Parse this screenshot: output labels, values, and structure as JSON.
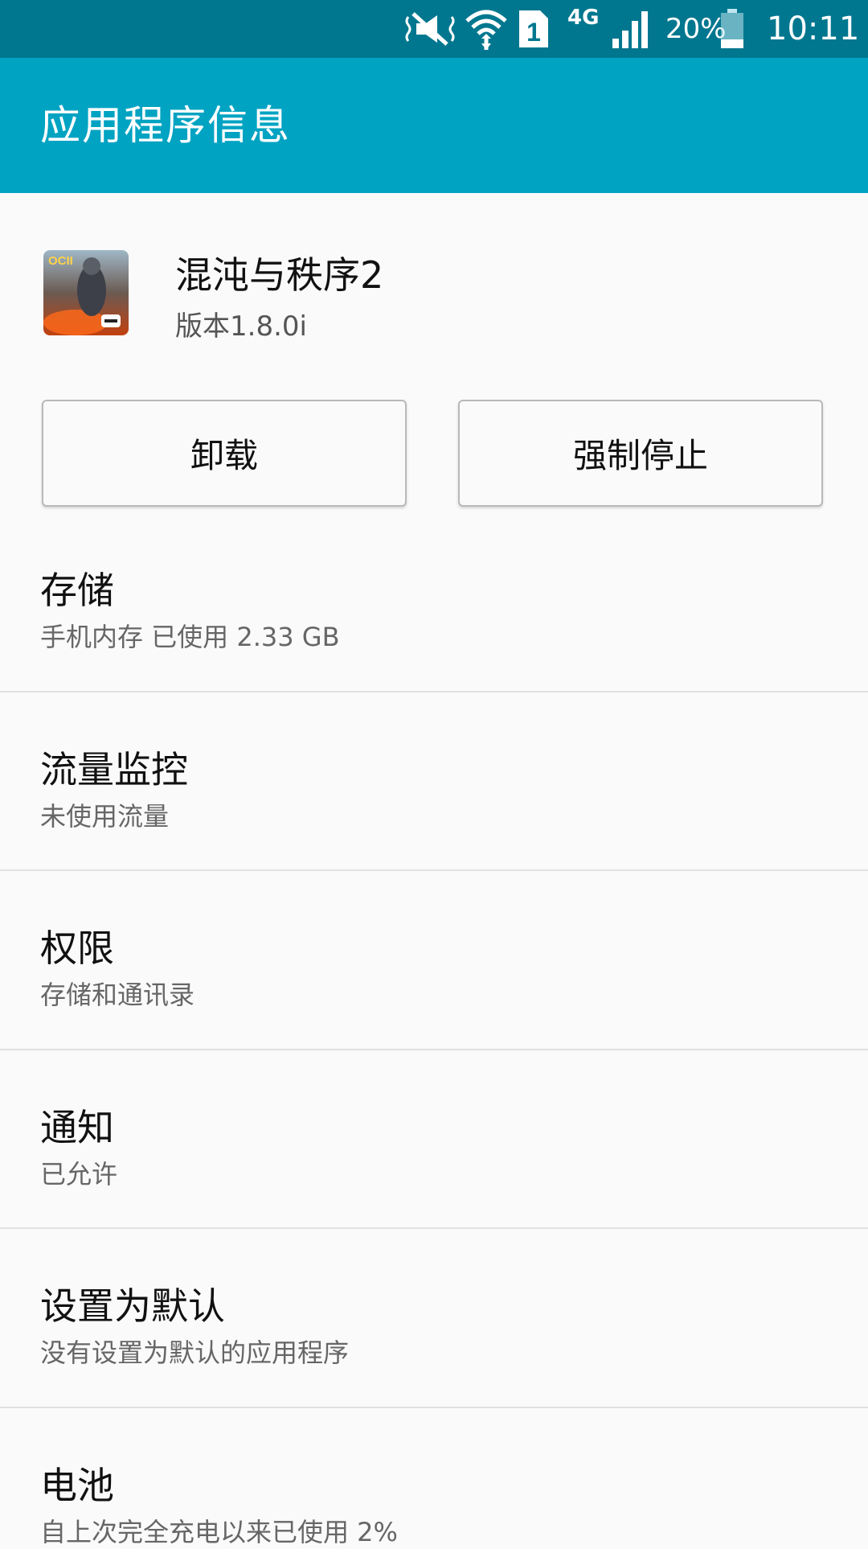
{
  "status_bar": {
    "battery_text": "20%",
    "time": "10:11",
    "network": "4G",
    "sim_slot": "1",
    "icons": [
      "vibrate-mute-icon",
      "wifi-icon",
      "sim-icon",
      "network-4g-icon",
      "signal-icon",
      "battery-icon"
    ]
  },
  "app_bar": {
    "title": "应用程序信息"
  },
  "app": {
    "name": "混沌与秩序2",
    "version": "版本1.8.0i",
    "icon_badge": "OCII"
  },
  "buttons": {
    "uninstall": "卸载",
    "force_stop": "强制停止"
  },
  "items": [
    {
      "title": "存储",
      "subtitle": "手机内存 已使用 2.33 GB"
    },
    {
      "title": "流量监控",
      "subtitle": "未使用流量"
    },
    {
      "title": "权限",
      "subtitle": "存储和通讯录"
    },
    {
      "title": "通知",
      "subtitle": "已允许"
    },
    {
      "title": "设置为默认",
      "subtitle": "没有设置为默认的应用程序"
    },
    {
      "title": "电池",
      "subtitle": "自上次完全充电以来已使用 2%"
    }
  ],
  "colors": {
    "status_bar": "#00778f",
    "app_bar": "#00a3c2",
    "background": "#fafafa"
  }
}
